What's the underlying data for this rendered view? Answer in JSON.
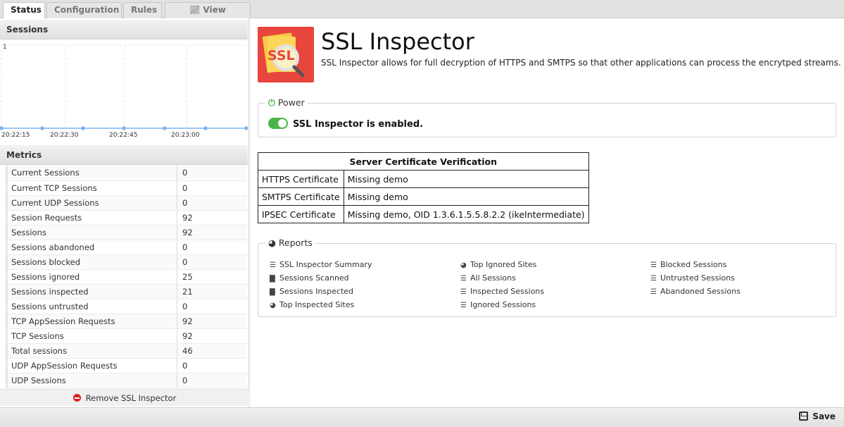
{
  "tabs": [
    {
      "label": "Status",
      "active": true
    },
    {
      "label": "Configuration",
      "active": false
    },
    {
      "label": "Rules",
      "active": false
    },
    {
      "label": "View Reports",
      "icon": "line-chart-icon",
      "active": false
    }
  ],
  "sessions_panel": {
    "title": "Sessions",
    "chart_data": {
      "type": "line",
      "title": "",
      "x": [
        "20:22:15",
        "20:22:30",
        "20:22:45",
        "20:23:00"
      ],
      "xticks": [
        "20:22:15",
        "20:22:30",
        "20:22:45",
        "20:23:00"
      ],
      "ylim": [
        0,
        1
      ],
      "yticks": [
        "1"
      ],
      "series": [
        {
          "values": [
            0,
            0,
            0,
            0,
            0,
            0,
            0
          ],
          "color": "#7cb5ec"
        }
      ],
      "grid": true
    }
  },
  "metrics_panel": {
    "title": "Metrics",
    "rows": [
      {
        "name": "Current Sessions",
        "value": "0"
      },
      {
        "name": "Current TCP Sessions",
        "value": "0"
      },
      {
        "name": "Current UDP Sessions",
        "value": "0"
      },
      {
        "name": "Session Requests",
        "value": "92"
      },
      {
        "name": "Sessions",
        "value": "92"
      },
      {
        "name": "Sessions abandoned",
        "value": "0"
      },
      {
        "name": "Sessions blocked",
        "value": "0"
      },
      {
        "name": "Sessions ignored",
        "value": "25"
      },
      {
        "name": "Sessions inspected",
        "value": "21"
      },
      {
        "name": "Sessions untrusted",
        "value": "0"
      },
      {
        "name": "TCP AppSession Requests",
        "value": "92"
      },
      {
        "name": "TCP Sessions",
        "value": "92"
      },
      {
        "name": "Total sessions",
        "value": "46"
      },
      {
        "name": "UDP AppSession Requests",
        "value": "0"
      },
      {
        "name": "UDP Sessions",
        "value": "0"
      }
    ],
    "remove_label": "Remove SSL Inspector"
  },
  "app": {
    "logo_text": "SSL",
    "title": "SSL Inspector",
    "description": "SSL Inspector allows for full decryption of HTTPS and SMTPS so that other applications can process the encrytped streams."
  },
  "power": {
    "legend": "Power",
    "status": "SSL Inspector is enabled.",
    "enabled": true
  },
  "cert_table": {
    "title": "Server Certificate Verification",
    "rows": [
      {
        "key": "HTTPS Certificate",
        "value": "Missing demo"
      },
      {
        "key": "SMTPS Certificate",
        "value": "Missing demo"
      },
      {
        "key": "IPSEC Certificate",
        "value": "Missing demo, OID 1.3.6.1.5.5.8.2.2 (ikeIntermediate)"
      }
    ]
  },
  "reports": {
    "legend": "Reports",
    "columns": [
      [
        {
          "label": "SSL Inspector Summary",
          "icon": "align-left-icon"
        },
        {
          "label": "Sessions Scanned",
          "icon": "bar-chart-icon"
        },
        {
          "label": "Sessions Inspected",
          "icon": "bar-chart-icon"
        },
        {
          "label": "Top Inspected Sites",
          "icon": "pie-chart-icon"
        }
      ],
      [
        {
          "label": "Top Ignored Sites",
          "icon": "pie-chart-icon"
        },
        {
          "label": "All Sessions",
          "icon": "list-icon"
        },
        {
          "label": "Inspected Sessions",
          "icon": "list-icon"
        },
        {
          "label": "Ignored Sessions",
          "icon": "list-icon"
        }
      ],
      [
        {
          "label": "Blocked Sessions",
          "icon": "list-icon"
        },
        {
          "label": "Untrusted Sessions",
          "icon": "list-icon"
        },
        {
          "label": "Abandoned Sessions",
          "icon": "list-icon"
        }
      ]
    ]
  },
  "footer": {
    "save_label": "Save"
  },
  "colors": {
    "accent_green": "#4bb548",
    "logo_red": "#e8453c",
    "chart_line": "#7cb5ec",
    "remove_red": "#d9221c"
  }
}
